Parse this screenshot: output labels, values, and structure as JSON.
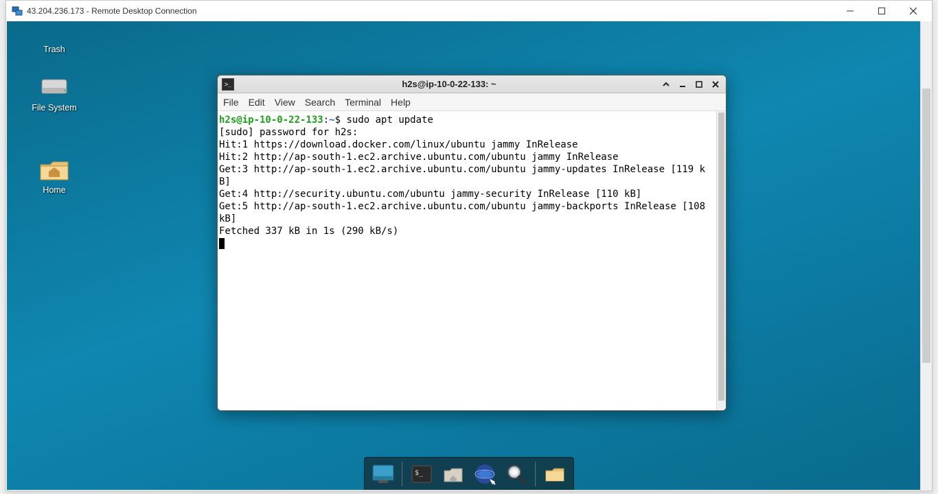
{
  "rdc": {
    "title": "43.204.236.173 - Remote Desktop Connection"
  },
  "desktop_icons": {
    "trash": "Trash",
    "filesystem": "File System",
    "home": "Home"
  },
  "terminal": {
    "title": "h2s@ip-10-0-22-133: ~",
    "menus": [
      "File",
      "Edit",
      "View",
      "Search",
      "Terminal",
      "Help"
    ],
    "prompt": {
      "userhost": "h2s@ip-10-0-22-133",
      "path": "~",
      "symbol": "$",
      "command": "sudo apt update"
    },
    "output": [
      "[sudo] password for h2s:",
      "Hit:1 https://download.docker.com/linux/ubuntu jammy InRelease",
      "Hit:2 http://ap-south-1.ec2.archive.ubuntu.com/ubuntu jammy InRelease",
      "Get:3 http://ap-south-1.ec2.archive.ubuntu.com/ubuntu jammy-updates InRelease [119 kB]",
      "Get:4 http://security.ubuntu.com/ubuntu jammy-security InRelease [110 kB]",
      "Get:5 http://ap-south-1.ec2.archive.ubuntu.com/ubuntu jammy-backports InRelease [108 kB]",
      "Fetched 337 kB in 1s (290 kB/s)"
    ]
  },
  "dock": {
    "items": [
      {
        "name": "show-desktop-icon"
      },
      {
        "name": "terminal-icon"
      },
      {
        "name": "file-manager-icon"
      },
      {
        "name": "web-browser-icon"
      },
      {
        "name": "app-finder-icon"
      },
      {
        "name": "folder-icon"
      }
    ]
  }
}
